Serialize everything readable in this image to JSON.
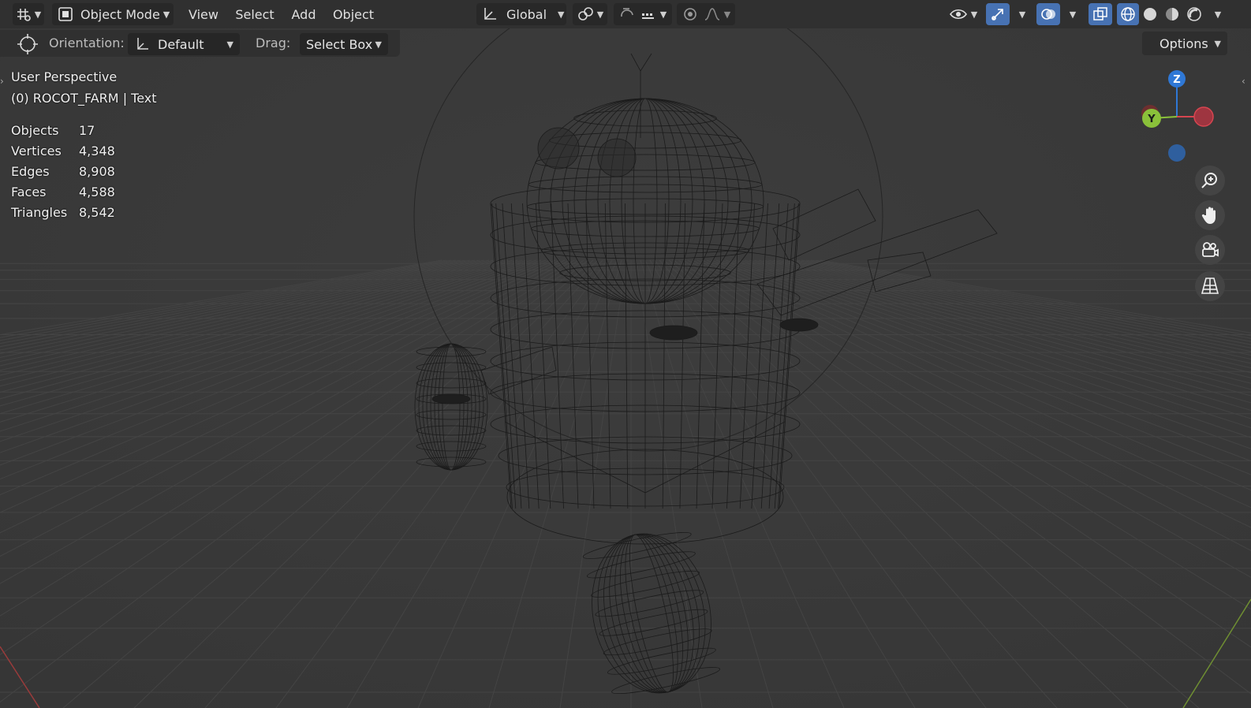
{
  "header": {
    "mode_label": "Object Mode",
    "menus": [
      "View",
      "Select",
      "Add",
      "Object"
    ],
    "transform_orientation": "Global"
  },
  "tool_settings": {
    "orientation_label": "Orientation:",
    "orientation_value": "Default",
    "drag_label": "Drag:",
    "drag_value": "Select Box",
    "options_label": "Options"
  },
  "overlay": {
    "view_name": "User Perspective",
    "object_info": "(0) ROCOT_FARM | Text",
    "stats": [
      {
        "label": "Objects",
        "value": "17"
      },
      {
        "label": "Vertices",
        "value": "4,348"
      },
      {
        "label": "Edges",
        "value": "8,908"
      },
      {
        "label": "Faces",
        "value": "4,588"
      },
      {
        "label": "Triangles",
        "value": "8,542"
      }
    ]
  },
  "gizmo": {
    "z_label": "Z",
    "y_label": "Y"
  },
  "colors": {
    "accent_blue": "#4772b3",
    "axis_x": "#d64550",
    "axis_y": "#8ac13a",
    "axis_z": "#2f78d6"
  },
  "icons": {
    "editor_type": "editor-type-icon",
    "mode": "object-mode-icon",
    "pivot": "pivot-point-icon",
    "snap": "snap-icon",
    "proportional": "proportional-editing-icon",
    "visibility": "visibility-icon",
    "gizmo_toggle": "gizmo-toggle-icon",
    "overlays": "overlays-icon",
    "xray": "xray-icon",
    "shading": [
      "wireframe-shading-icon",
      "solid-shading-icon",
      "material-shading-icon",
      "rendered-shading-icon"
    ],
    "nav": [
      "zoom-icon",
      "pan-hand-icon",
      "camera-icon",
      "grid-view-icon"
    ]
  }
}
